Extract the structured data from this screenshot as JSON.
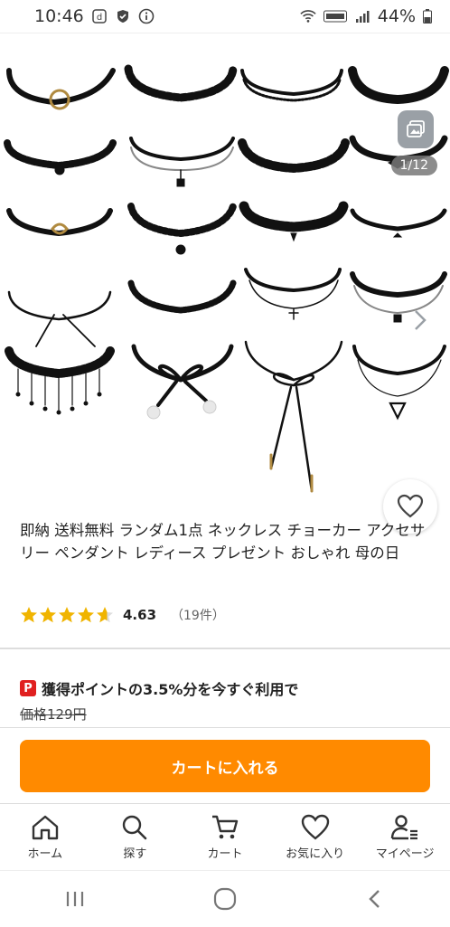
{
  "status": {
    "time": "10:46",
    "battery": "44%"
  },
  "gallery": {
    "page_counter": "1/12"
  },
  "product": {
    "title": "即納 送料無料 ランダム1点 ネックレス チョーカー アクセサリー ペンダント レディース プレゼント おしゃれ 母の日",
    "rating_value": "4.63",
    "rating_count": "（19件）",
    "rating_stars": 4.63,
    "point_text": "獲得ポイントの3.5%分を今すぐ利用で",
    "old_price": "価格129円",
    "point_icon": "P"
  },
  "actions": {
    "cart_label": "カートに入れる"
  },
  "tabs": [
    {
      "label": "ホーム",
      "icon": "home-icon"
    },
    {
      "label": "探す",
      "icon": "search-icon"
    },
    {
      "label": "カート",
      "icon": "cart-icon"
    },
    {
      "label": "お気に入り",
      "icon": "heart-icon"
    },
    {
      "label": "マイページ",
      "icon": "user-icon"
    }
  ],
  "colors": {
    "accent": "#ff8a00",
    "star": "#f0b400",
    "point_red": "#e02020"
  }
}
